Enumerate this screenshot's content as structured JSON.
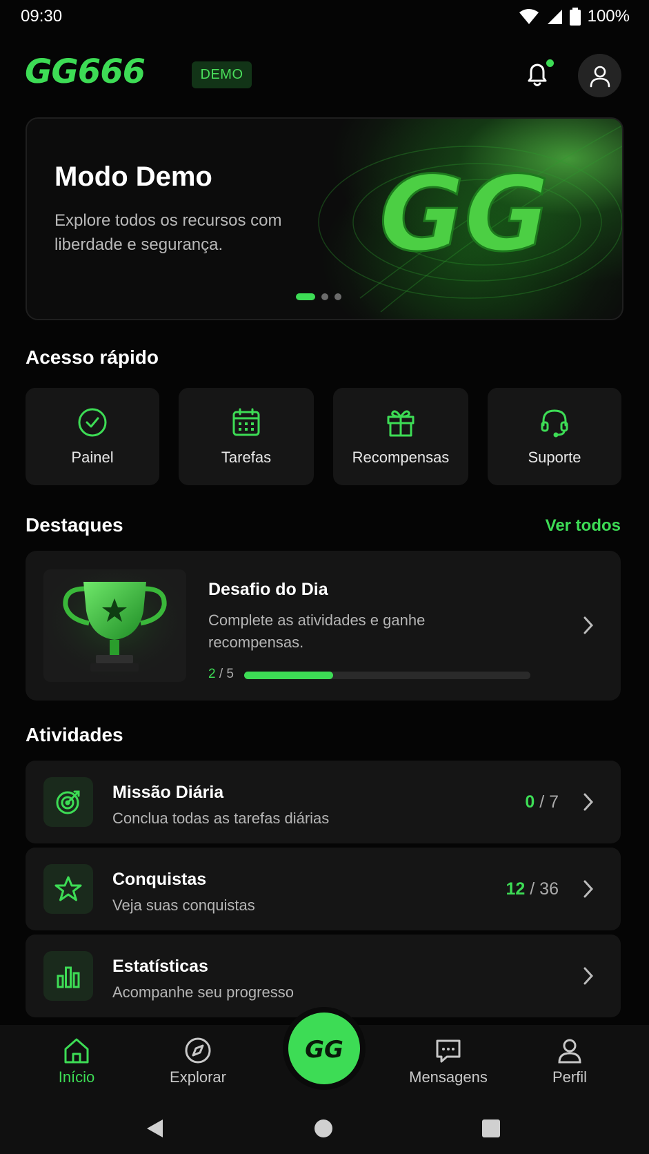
{
  "status_bar": {
    "time": "09:30",
    "battery": "100%"
  },
  "header": {
    "logo_text": "GG666",
    "badge": "DEMO"
  },
  "banner": {
    "title": "Modo Demo",
    "subtitle": "Explore todos os recursos com liberdade e segurança.",
    "art_text": "GG",
    "active_slide": 1,
    "slide_count": 3
  },
  "quick_access": {
    "title": "Acesso rápido",
    "items": [
      {
        "label": "Painel",
        "icon": "check-circle-icon"
      },
      {
        "label": "Tarefas",
        "icon": "calendar-icon"
      },
      {
        "label": "Recompensas",
        "icon": "gift-icon"
      },
      {
        "label": "Suporte",
        "icon": "headset-icon"
      }
    ]
  },
  "highlights": {
    "title": "Destaques",
    "see_all": "Ver todos",
    "card": {
      "title": "Desafio do Dia",
      "description": "Complete as atividades e ganhe recompensas.",
      "progress_done": "2",
      "progress_total": "/ 5",
      "progress_fraction": 0.31
    }
  },
  "activities": {
    "title": "Atividades",
    "items": [
      {
        "title": "Missão Diária",
        "subtitle": "Conclua todas as tarefas diárias",
        "count_done": "0",
        "count_total": " / 7",
        "icon": "target-icon"
      },
      {
        "title": "Conquistas",
        "subtitle": "Veja suas conquistas",
        "count_done": "12",
        "count_total": " / 36",
        "icon": "star-icon"
      },
      {
        "title": "Estatísticas",
        "subtitle": "Acompanhe seu progresso",
        "count_done": "",
        "count_total": "",
        "icon": "bar-chart-icon"
      }
    ]
  },
  "bottom_nav": {
    "items": [
      {
        "label": "Início",
        "icon": "home-icon",
        "active": true
      },
      {
        "label": "Explorar",
        "icon": "compass-icon",
        "active": false
      },
      {
        "label": "Mensagens",
        "icon": "chat-icon",
        "active": false
      },
      {
        "label": "Perfil",
        "icon": "user-icon",
        "active": false
      }
    ],
    "center_label": "GG"
  },
  "colors": {
    "accent": "#3ddc55",
    "background": "#050505",
    "card": "#151515"
  }
}
